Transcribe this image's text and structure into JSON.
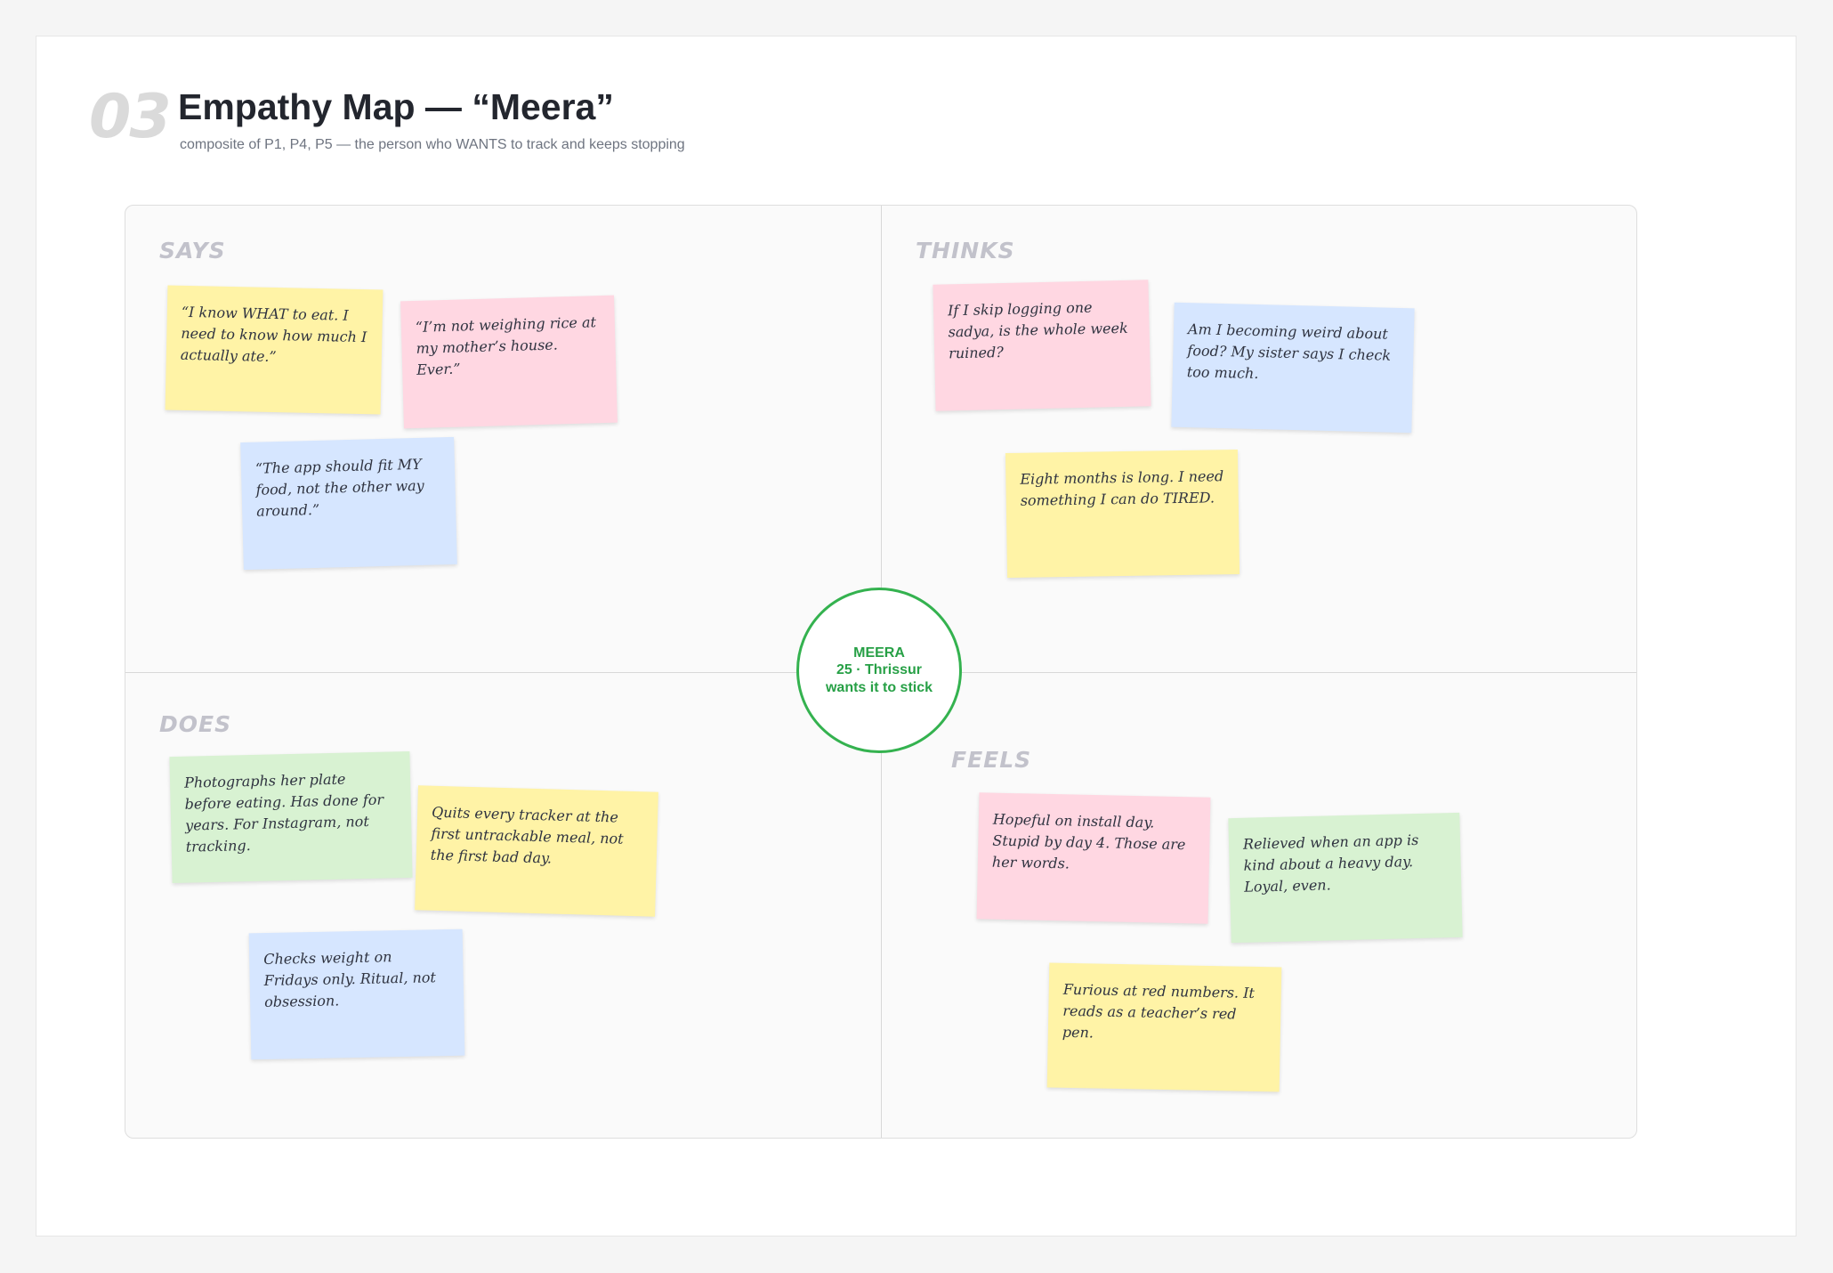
{
  "header": {
    "section_number": "03",
    "title": "Empathy Map — “Meera”",
    "subtitle": "composite of P1, P4, P5 — the person who WANTS to track and keeps stopping"
  },
  "persona": {
    "name": "MEERA",
    "detail": "25 · Thrissur",
    "goal": "wants it to stick"
  },
  "quadrants": {
    "says": {
      "label": "SAYS",
      "notes": [
        "“I know WHAT to eat. I need to know how much I actually ate.”",
        "“I’m not weighing rice at my mother’s house. Ever.”",
        "“The app should fit MY food, not the other way around.”"
      ]
    },
    "thinks": {
      "label": "THINKS",
      "notes": [
        "If I skip logging one sadya, is the whole week ruined?",
        "Am I becoming weird about food? My sister says I check too much.",
        "Eight months is long. I need something I can do TIRED."
      ]
    },
    "does": {
      "label": "DOES",
      "notes": [
        "Photographs her plate before eating. Has done for years. For Instagram, not tracking.",
        "Quits every tracker at the first untrackable meal, not the first bad day.",
        "Checks weight on Fridays only. Ritual, not obsession."
      ]
    },
    "feels": {
      "label": "FEELS",
      "notes": [
        "Hopeful on install day. Stupid by day 4. Those are her words.",
        "Relieved when an app is kind about a heavy day. Loyal, even.",
        "Furious at red numbers. It reads as a teacher’s red pen."
      ]
    }
  },
  "colors": {
    "yellow": "#fff3a6",
    "pink": "#ffd7e2",
    "blue": "#d6e6ff",
    "green": "#d8f2d2",
    "accent": "#34b24f"
  }
}
